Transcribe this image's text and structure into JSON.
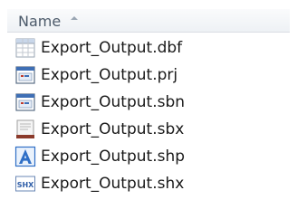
{
  "header": {
    "column_label": "Name"
  },
  "files": [
    {
      "name": "Export_Output.dbf",
      "icon": "table-file-icon"
    },
    {
      "name": "Export_Output.prj",
      "icon": "window-file-icon"
    },
    {
      "name": "Export_Output.sbn",
      "icon": "window-file-icon"
    },
    {
      "name": "Export_Output.sbx",
      "icon": "document-file-icon"
    },
    {
      "name": "Export_Output.shp",
      "icon": "shapefile-a-icon"
    },
    {
      "name": "Export_Output.shx",
      "icon": "shx-file-icon"
    }
  ],
  "colors": {
    "header_text": "#4c5a6a",
    "file_text": "#1a1a1a",
    "accent_blue": "#2f6fc6"
  }
}
